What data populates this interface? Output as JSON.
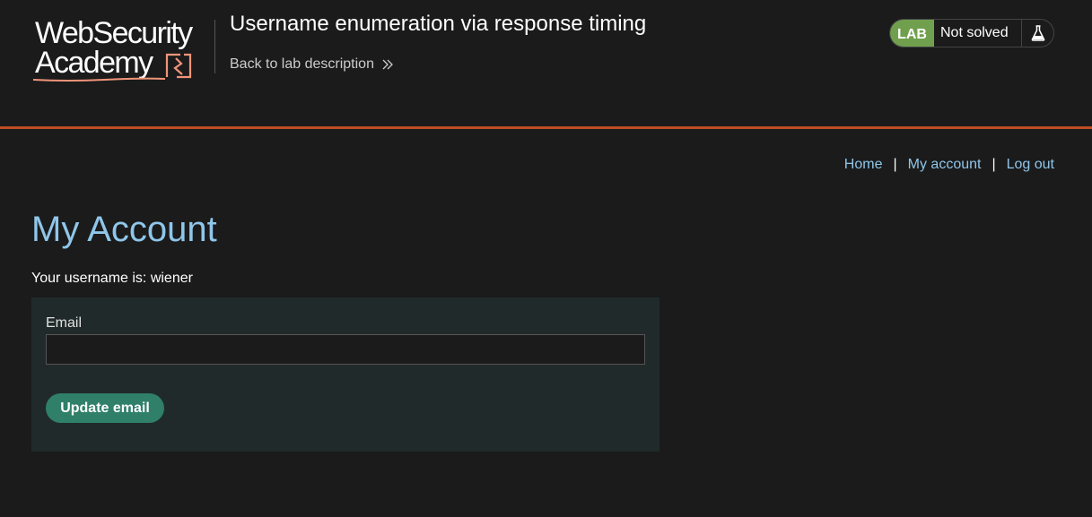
{
  "header": {
    "logo": {
      "line1": "WebSecurity",
      "line2": "Academy"
    },
    "lab_title": "Username enumeration via response timing",
    "back_link": "Back to lab description",
    "status": {
      "badge": "LAB",
      "text": "Not solved",
      "icon": "flask-icon"
    }
  },
  "nav": {
    "items": [
      {
        "label": "Home"
      },
      {
        "label": "My account"
      },
      {
        "label": "Log out"
      }
    ],
    "separator": "|"
  },
  "main": {
    "title": "My Account",
    "username_text": "Your username is: wiener",
    "form": {
      "email_label": "Email",
      "email_value": "",
      "button_label": "Update email"
    }
  },
  "colors": {
    "background": "#1b1b1b",
    "accent_rule": "#bd4e24",
    "link": "#8fc6ea",
    "lab_badge": "#70a04e",
    "button": "#2f7f69",
    "form_panel": "#212a2a"
  }
}
